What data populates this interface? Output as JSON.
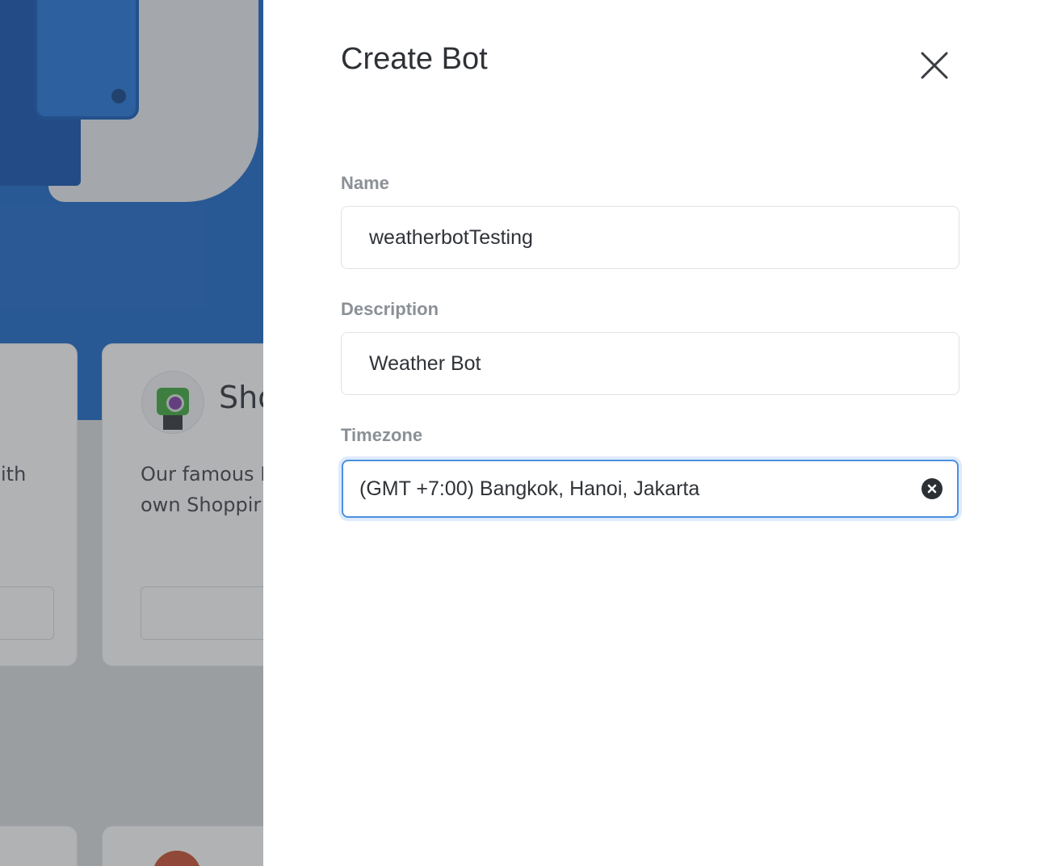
{
  "background": {
    "card_a_text": "ith",
    "card_b_title": "Sho",
    "card_b_desc_line1": "Our famous I",
    "card_b_desc_line2": "own Shoppir"
  },
  "panel": {
    "title": "Create Bot",
    "close_icon": "close-icon",
    "fields": {
      "name": {
        "label": "Name",
        "value": "weatherbotTesting"
      },
      "description": {
        "label": "Description",
        "value": "Weather Bot"
      },
      "timezone": {
        "label": "Timezone",
        "value": "(GMT +7:00) Bangkok, Hanoi, Jakarta"
      }
    }
  },
  "colors": {
    "accent": "#4a90e2",
    "hero_blue": "#1566c9",
    "label_gray": "#8b9096"
  }
}
